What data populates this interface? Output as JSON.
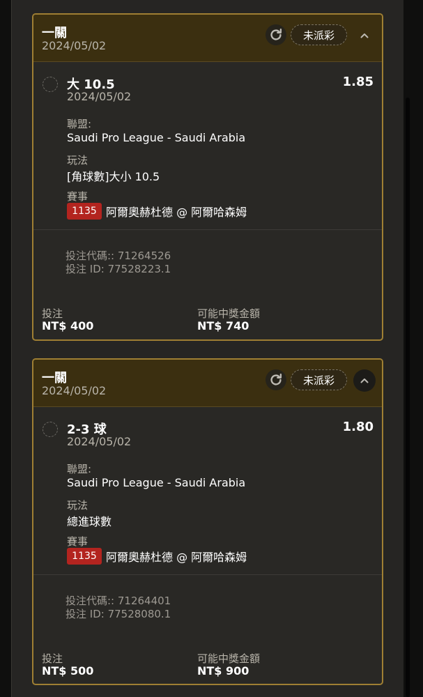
{
  "colors": {
    "border_gold": "#9f7f33",
    "header_bg": "#3b2f10",
    "badge_red": "#b3241f"
  },
  "cards": [
    {
      "header_title": "一關",
      "header_date": "2024/05/02",
      "status": "未派彩",
      "bet_name": "大 10.5",
      "odds": "1.85",
      "bet_date": "2024/05/02",
      "league_label": "聯盟:",
      "league": "Saudi Pro League - Saudi Arabia",
      "play_label": "玩法",
      "play": "[角球數]大小 10.5",
      "event_label": "賽事",
      "event_id": "1135",
      "event": "阿爾奧赫杜德 @ 阿爾哈森姆",
      "bet_code": "投注代碼:: 71264526",
      "bet_id": "投注 ID: 77528223.1",
      "stake_label": "投注",
      "stake": "NT$ 400",
      "payout_label": "可能中獎金額",
      "payout": "NT$ 740"
    },
    {
      "header_title": "一關",
      "header_date": "2024/05/02",
      "status": "未派彩",
      "bet_name": "2-3 球",
      "odds": "1.80",
      "bet_date": "2024/05/02",
      "league_label": "聯盟:",
      "league": "Saudi Pro League - Saudi Arabia",
      "play_label": "玩法",
      "play": "總進球數",
      "event_label": "賽事",
      "event_id": "1135",
      "event": "阿爾奧赫杜德 @ 阿爾哈森姆",
      "bet_code": "投注代碼:: 71264401",
      "bet_id": "投注 ID: 77528080.1",
      "stake_label": "投注",
      "stake": "NT$ 500",
      "payout_label": "可能中獎金額",
      "payout": "NT$ 900"
    }
  ]
}
